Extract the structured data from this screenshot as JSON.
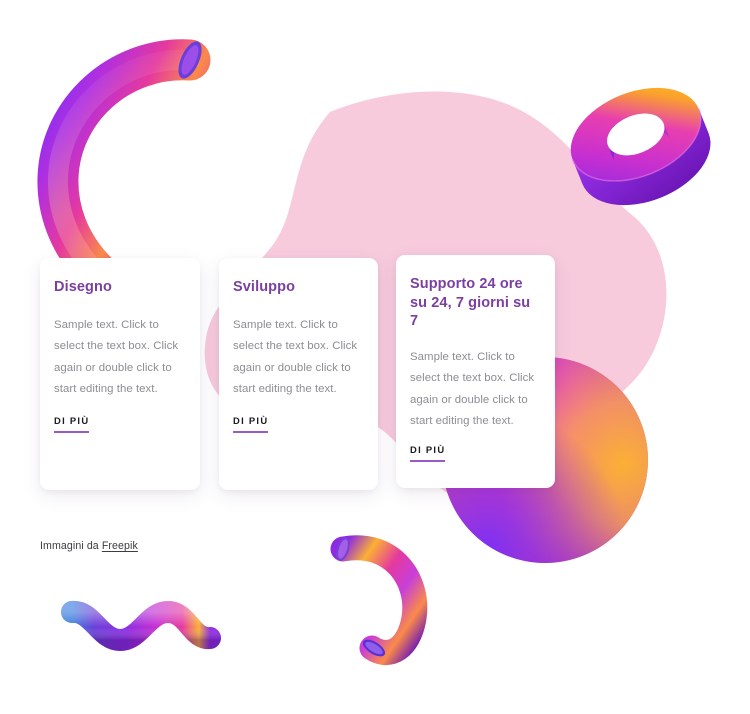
{
  "page": {
    "background_color": "#ffffff",
    "accent_purple": "#7b3fa0",
    "link_underline_color": "#9b59c7",
    "blob_pink": "#f7cadc",
    "body_text_color": "#8d8d93"
  },
  "cards": [
    {
      "title": "Disegno",
      "body": "Sample text. Click to select the text box. Click again or double click to start editing the text.",
      "link_label": "DI PIÙ"
    },
    {
      "title": "Sviluppo",
      "body": "Sample text. Click to select the text box. Click again or double click to start editing the text.",
      "link_label": "DI PIÙ"
    },
    {
      "title": "Supporto 24 ore su 24, 7 giorni su 7",
      "body": "Sample text. Click to select the text box. Click again or double click to start editing the text.",
      "link_label": "DI PIÙ"
    }
  ],
  "credit": {
    "prefix": "Immagini da ",
    "link_label": "Freepik"
  },
  "decorations": [
    {
      "name": "pink-blob",
      "shape": "organic-blob",
      "color": "#f7cadc"
    },
    {
      "name": "torus-3d",
      "shape": "tilted-ring",
      "colors": [
        "#7b2ff7",
        "#e03fd8",
        "#fbb034"
      ]
    },
    {
      "name": "arc-tube-top-left",
      "shape": "c-arc",
      "colors": [
        "#7b2ff7",
        "#e03fd8",
        "#fbb034"
      ]
    },
    {
      "name": "arc-tube-bottom",
      "shape": "c-arc",
      "colors": [
        "#7b2ff7",
        "#e03fd8",
        "#fbb034"
      ]
    },
    {
      "name": "gradient-sphere",
      "shape": "sphere",
      "colors": [
        "#e23fd0",
        "#fbb034",
        "#7b2ff7"
      ]
    },
    {
      "name": "wave-ribbon",
      "shape": "zigzag-wave",
      "colors": [
        "#3b7ddd",
        "#7b2ff7",
        "#e03fd8",
        "#fbb034"
      ]
    }
  ]
}
